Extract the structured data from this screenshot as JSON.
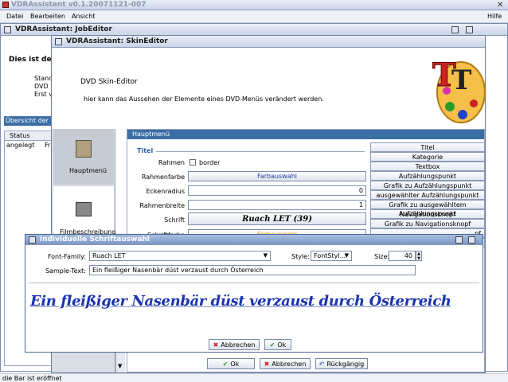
{
  "main": {
    "title": "VDRAssistant v0.1.20071121-007",
    "menu": [
      "Datei",
      "Bearbeiten",
      "Ansicht"
    ],
    "help": "Hilfe",
    "status": "die Bar ist eröffnet"
  },
  "job": {
    "title": "VDRAssistant: JobEditor",
    "heading": "Dies ist der",
    "lines": [
      "Stand",
      "DVD",
      "Erst v"
    ],
    "overview": "Übersicht der",
    "col_status": "Status",
    "cell_status": "angelegt",
    "cell_next": "Fr"
  },
  "skin": {
    "title": "VDRAssistant: SkinEditor",
    "heading": "DVD Skin-Editor",
    "desc": "hier kann das Aussehen der Elemente eines DVD-Menüs verändert werden.",
    "nav": [
      "Hauptmenü",
      "Filmbeschreibung"
    ],
    "panel_title": "Hauptmenü",
    "group": "Titel",
    "rahmen_label": "Rahmen",
    "rahmen_check": "border",
    "rahmenfarbe_label": "Rahmenfarbe",
    "farbauswahl": "Farbauswahl",
    "eckenradius_label": "Eckenradius",
    "eckenradius": "0",
    "rahmenbreite_label": "Rahmenbreite",
    "rahmenbreite": "1",
    "schrift_label": "Schrift",
    "schrift_value": "Ruach LET (39)",
    "schriftfarbe_label": "Schriftfarbe",
    "schriftfarbe_value": "Farbauswahl",
    "elements": [
      "Titel",
      "Kategorie",
      "Textbox",
      "Aufzählungspunkt",
      "Grafik zu Aufzählungspunkt",
      "ausgewählter Aufzählungspunkt",
      "Grafik zu ausgewähltem Aufzählungspunkt",
      "Navigationsknopf",
      "Grafik zu Navigationsknopf"
    ],
    "element_partial_1": "pf",
    "element_partial_2": "sknopf",
    "ok": "Ok",
    "cancel": "Abbrechen",
    "undo": "Rückgängig"
  },
  "font": {
    "title": "individuelle Schriftauswahl",
    "family_label": "Font-Family:",
    "family": "Ruach LET",
    "style_label": "Style:",
    "style": "FontStyl...",
    "size_label": "Size:",
    "size": "40",
    "sample_label": "Sample-Text:",
    "sample": "Ein fleißiger Nasenbär düst verzaust durch Österreich",
    "cancel": "Abbrechen",
    "ok": "Ok"
  },
  "colors": {
    "accent": "#3a6ea5",
    "title_blue": "#2d5da8",
    "sample_blue": "#1a33b0",
    "farbe_blue": "#1a3b9c",
    "farbe_orange": "#e8a000"
  }
}
